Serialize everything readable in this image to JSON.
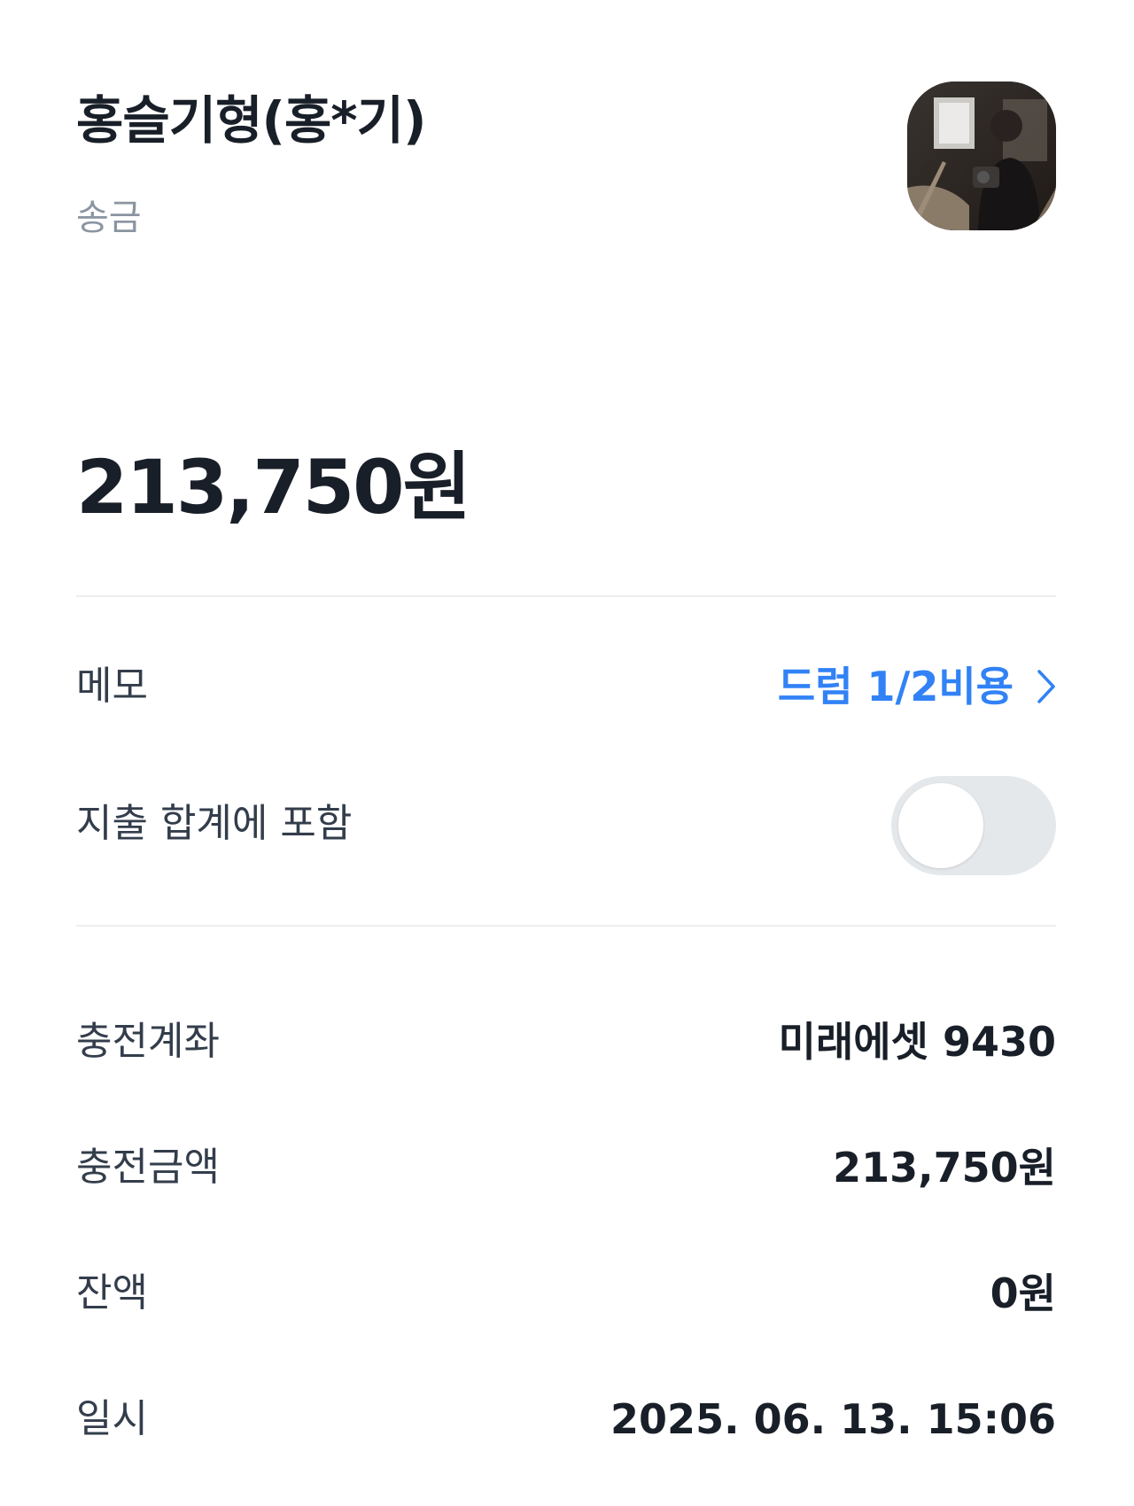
{
  "header": {
    "recipient_name": "홍슬기형(홍*기)",
    "transaction_type": "송금"
  },
  "amount": "213,750원",
  "memo": {
    "label": "메모",
    "value": "드럼 1/2비용",
    "link_color": "#3182f6"
  },
  "include_in_total": {
    "label": "지출 합계에 포함",
    "enabled": false
  },
  "details": [
    {
      "label": "충전계좌",
      "value": "미래에셋 9430"
    },
    {
      "label": "충전금액",
      "value": "213,750원"
    },
    {
      "label": "잔액",
      "value": "0원"
    },
    {
      "label": "일시",
      "value": "2025. 06. 13. 15:06"
    }
  ],
  "icons": {
    "memo_chevron": "chevron-right-icon"
  }
}
